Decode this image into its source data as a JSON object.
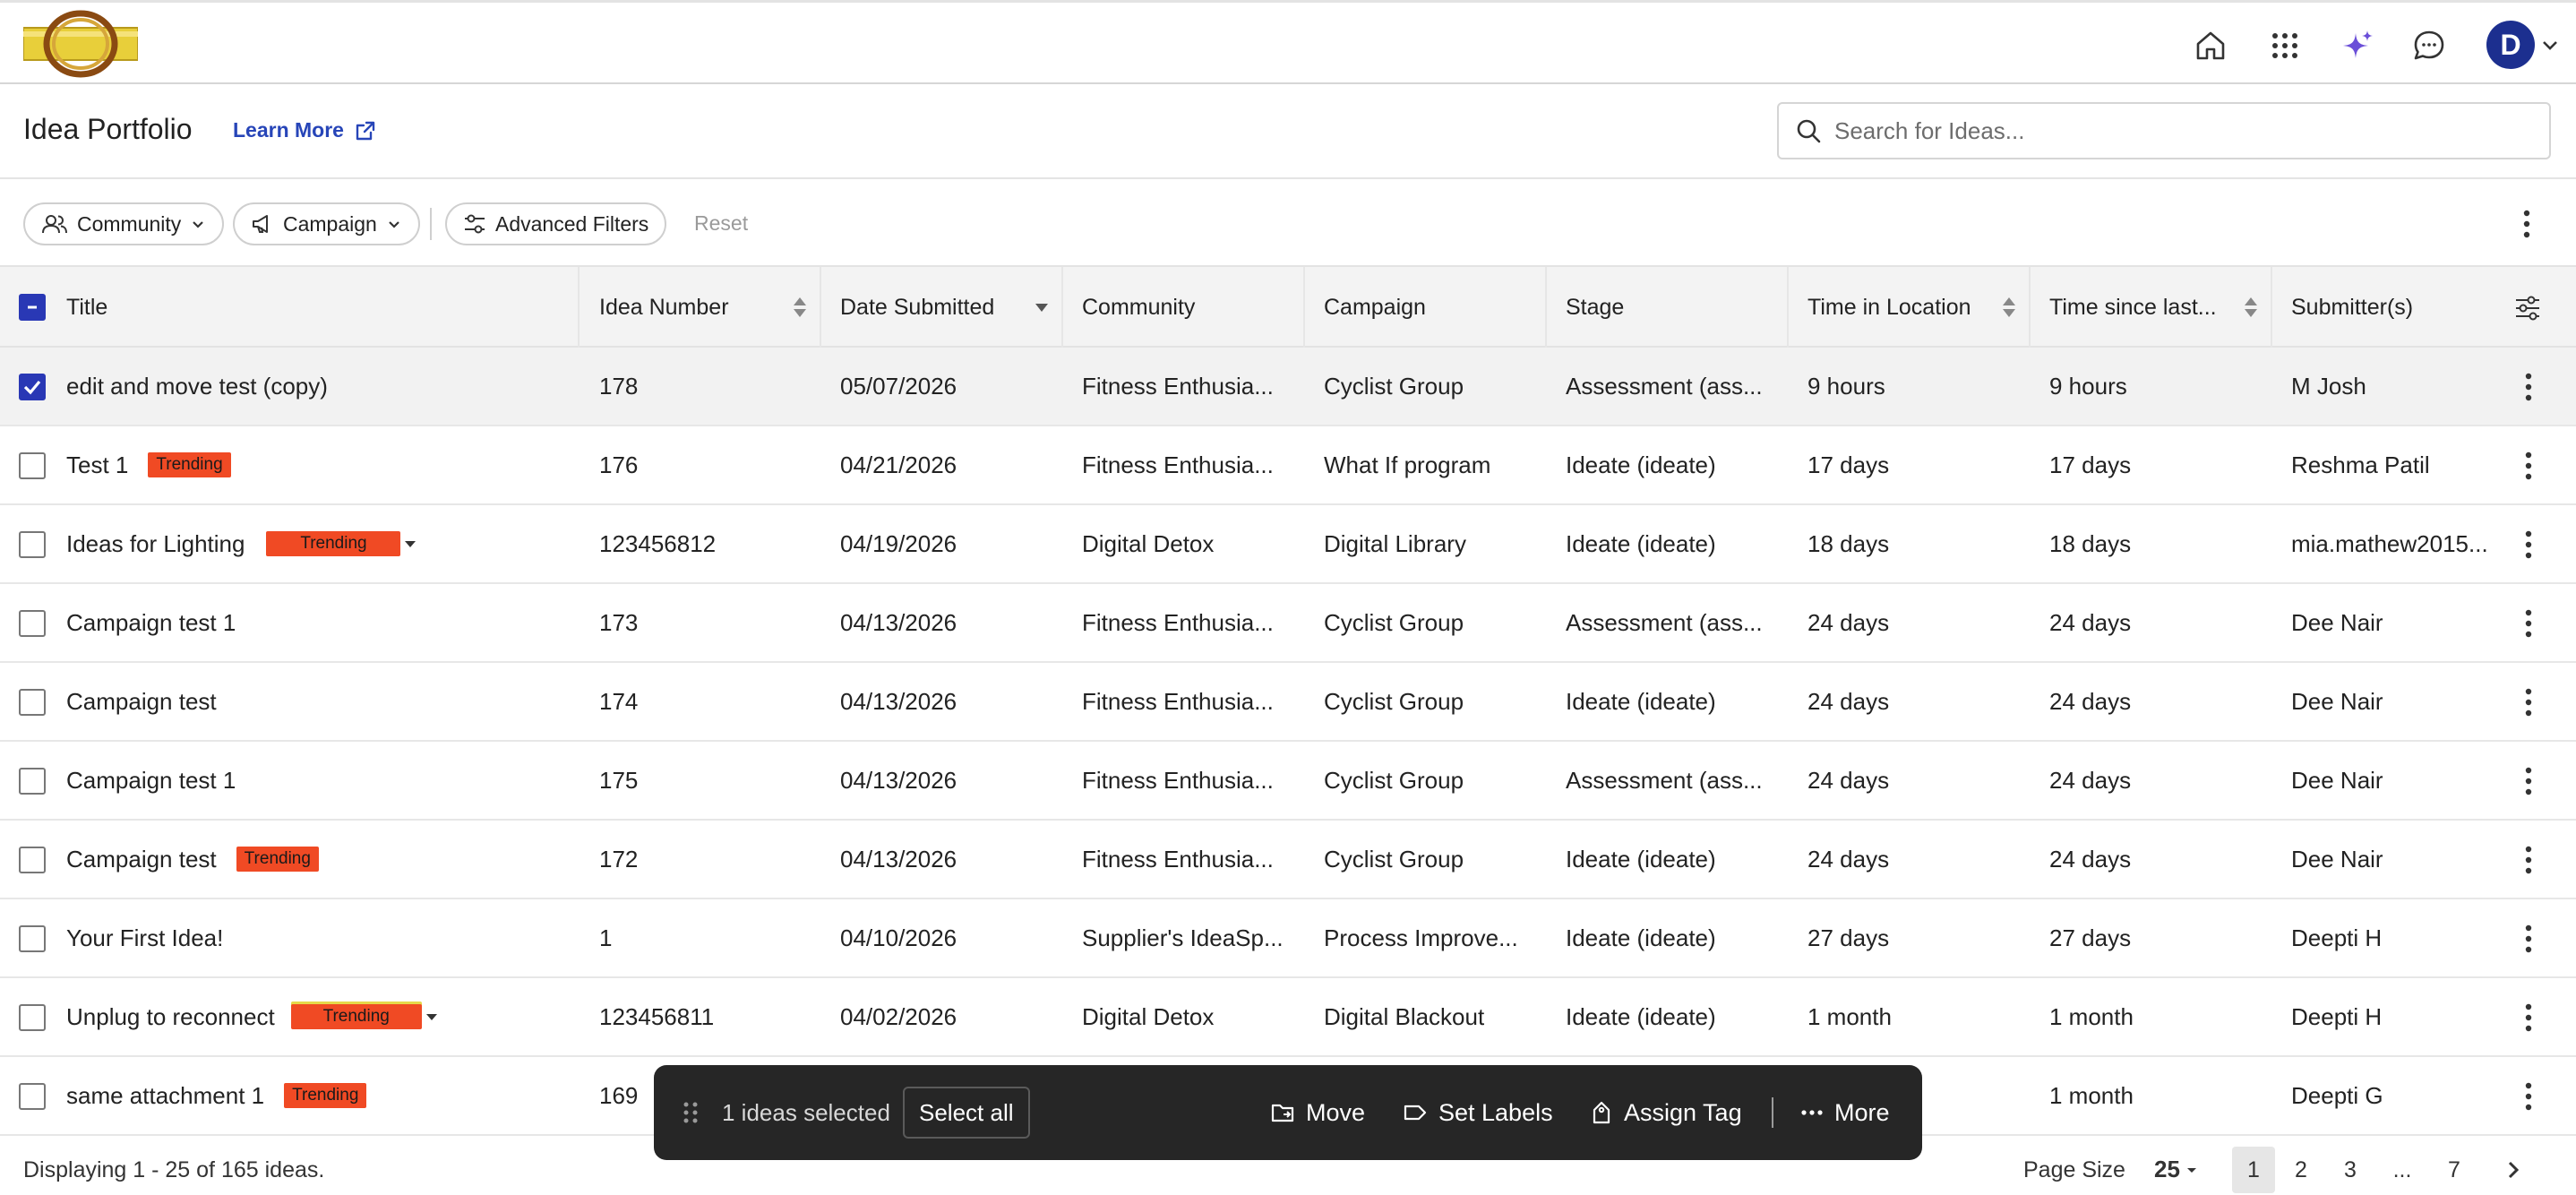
{
  "app": {
    "page_title": "Idea Portfolio",
    "learn_more": "Learn More",
    "avatar_initial": "D"
  },
  "search": {
    "placeholder": "Search for Ideas..."
  },
  "filters": {
    "community": "Community",
    "campaign": "Campaign",
    "advanced": "Advanced Filters",
    "reset": "Reset"
  },
  "columns": {
    "title": "Title",
    "idea_number": "Idea Number",
    "date_submitted": "Date Submitted",
    "community": "Community",
    "campaign": "Campaign",
    "stage": "Stage",
    "time_in_location": "Time in Location",
    "time_since_last": "Time since last...",
    "submitters": "Submitter(s)"
  },
  "badge_label": "Trending",
  "rows": [
    {
      "title": "edit and move test (copy)",
      "trending": false,
      "number": "178",
      "date": "05/07/2026",
      "community": "Fitness Enthusia...",
      "campaign": "Cyclist Group",
      "stage": "Assessment (ass...",
      "time_in_location": "9 hours",
      "time_since_last": "9 hours",
      "submitter": "M Josh",
      "selected": true
    },
    {
      "title": "Test 1",
      "trending": true,
      "number": "176",
      "date": "04/21/2026",
      "community": "Fitness Enthusia...",
      "campaign": "What If program",
      "stage": "Ideate (ideate)",
      "time_in_location": "17 days",
      "time_since_last": "17 days",
      "submitter": "Reshma Patil",
      "selected": false
    },
    {
      "title": "Ideas for Lighting",
      "trending": true,
      "number": "123456812",
      "date": "04/19/2026",
      "community": "Digital Detox",
      "campaign": "Digital Library",
      "stage": "Ideate (ideate)",
      "time_in_location": "18 days",
      "time_since_last": "18 days",
      "submitter": "mia.mathew2015...",
      "selected": false
    },
    {
      "title": "Campaign test 1",
      "trending": false,
      "number": "173",
      "date": "04/13/2026",
      "community": "Fitness Enthusia...",
      "campaign": "Cyclist Group",
      "stage": "Assessment (ass...",
      "time_in_location": "24 days",
      "time_since_last": "24 days",
      "submitter": "Dee Nair",
      "selected": false
    },
    {
      "title": "Campaign test",
      "trending": false,
      "number": "174",
      "date": "04/13/2026",
      "community": "Fitness Enthusia...",
      "campaign": "Cyclist Group",
      "stage": "Ideate (ideate)",
      "time_in_location": "24 days",
      "time_since_last": "24 days",
      "submitter": "Dee Nair",
      "selected": false
    },
    {
      "title": "Campaign test 1",
      "trending": false,
      "number": "175",
      "date": "04/13/2026",
      "community": "Fitness Enthusia...",
      "campaign": "Cyclist Group",
      "stage": "Assessment (ass...",
      "time_in_location": "24 days",
      "time_since_last": "24 days",
      "submitter": "Dee Nair",
      "selected": false
    },
    {
      "title": "Campaign test",
      "trending": true,
      "number": "172",
      "date": "04/13/2026",
      "community": "Fitness Enthusia...",
      "campaign": "Cyclist Group",
      "stage": "Ideate (ideate)",
      "time_in_location": "24 days",
      "time_since_last": "24 days",
      "submitter": "Dee Nair",
      "selected": false
    },
    {
      "title": "Your First Idea!",
      "trending": false,
      "number": "1",
      "date": "04/10/2026",
      "community": "Supplier's IdeaSp...",
      "campaign": "Process Improve...",
      "stage": "Ideate (ideate)",
      "time_in_location": "27 days",
      "time_since_last": "27 days",
      "submitter": "Deepti H",
      "selected": false
    },
    {
      "title": "Unplug to reconnect",
      "trending": true,
      "number": "123456811",
      "date": "04/02/2026",
      "community": "Digital Detox",
      "campaign": "Digital Blackout",
      "stage": "Ideate (ideate)",
      "time_in_location": "1 month",
      "time_since_last": "1 month",
      "submitter": "Deepti H",
      "selected": false
    },
    {
      "title": "same attachment 1",
      "trending": true,
      "number": "169",
      "date": "",
      "community": "",
      "campaign": "",
      "stage": "",
      "time_in_location": "",
      "time_since_last": "1 month",
      "submitter": "Deepti G",
      "selected": false
    }
  ],
  "action_bar": {
    "count_text": "1 ideas selected",
    "select_all": "Select all",
    "move": "Move",
    "set_labels": "Set Labels",
    "assign_tag": "Assign Tag",
    "more": "More"
  },
  "footer": {
    "displaying": "Displaying 1 - 25 of 165 ideas.",
    "page_size_label": "Page Size",
    "page_size_value": "25",
    "pages": [
      "1",
      "2",
      "3",
      "...",
      "7"
    ],
    "current_page": "1"
  },
  "colors": {
    "accent": "#2938b5",
    "link": "#2745b8",
    "trending_badge": "#f04a24",
    "ai_sparkle": "#6b4fd8",
    "action_bar": "#262626"
  }
}
